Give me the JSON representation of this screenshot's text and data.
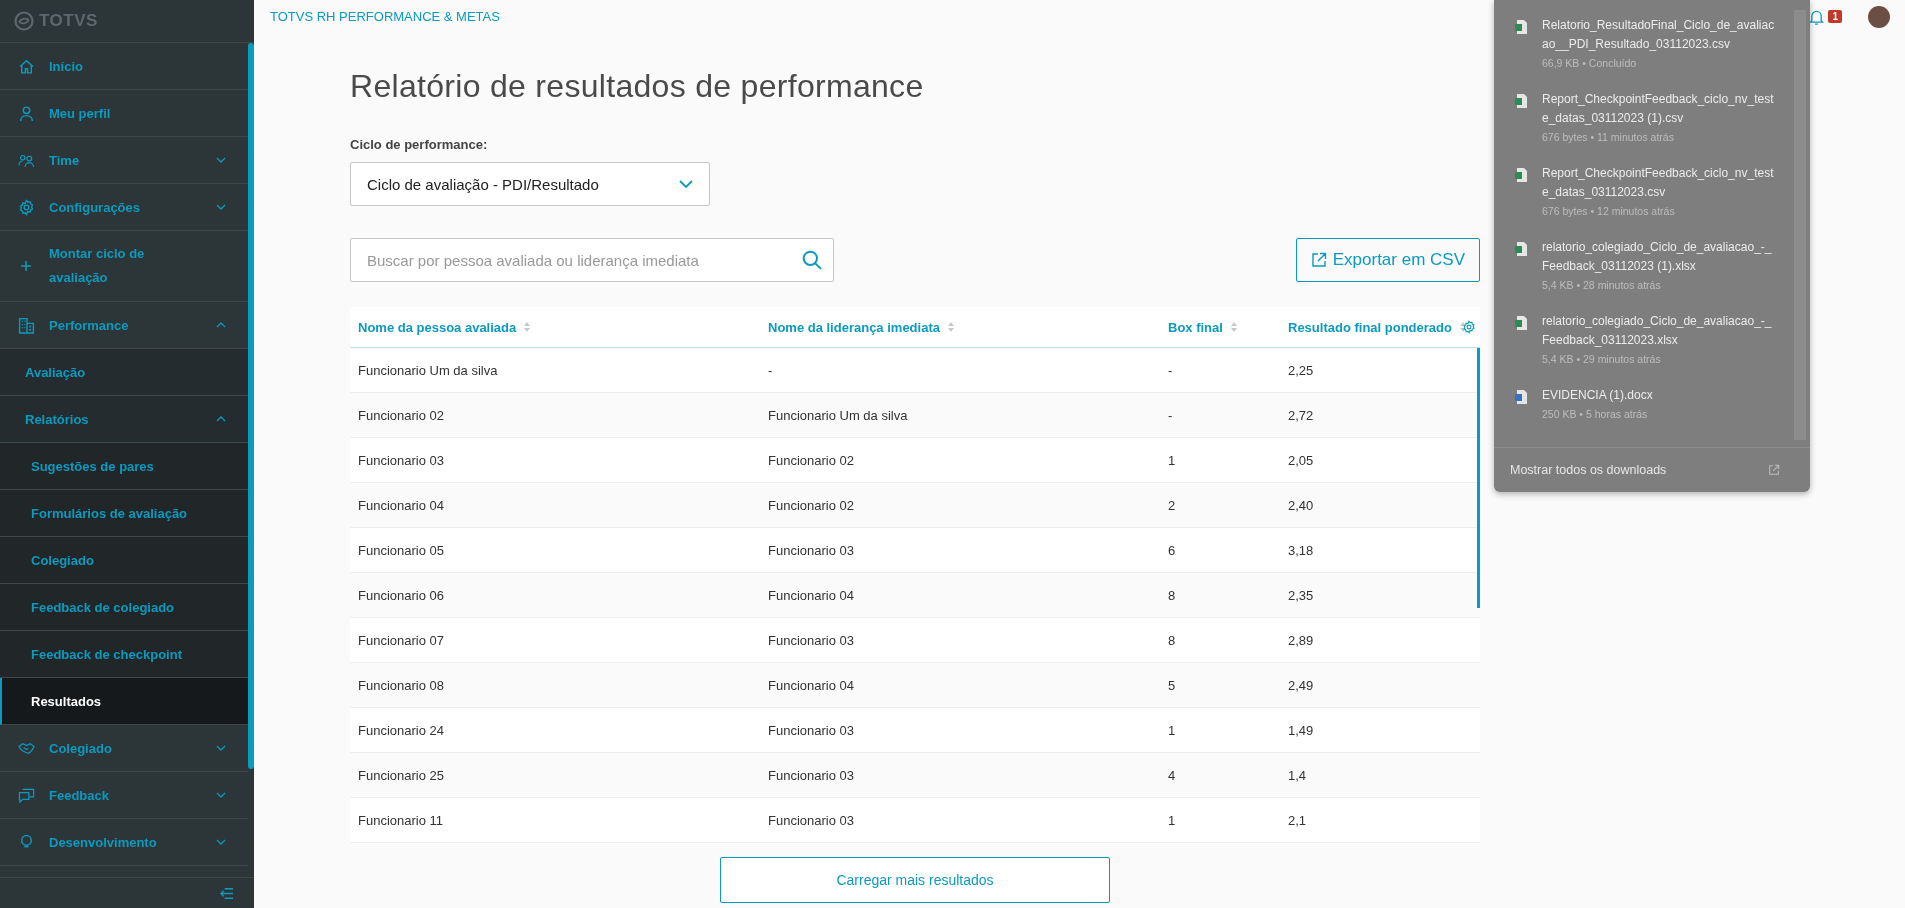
{
  "sidebar": {
    "logo": "TOTVS",
    "items": [
      {
        "label": "Início",
        "selected": false
      },
      {
        "label": "Meu perfil",
        "selected": false
      },
      {
        "label": "Time",
        "selected": false,
        "expanded": false
      },
      {
        "label": "Configurações",
        "selected": false,
        "expanded": false
      },
      {
        "label": "Montar ciclo de avaliação",
        "selected": false
      },
      {
        "label": "Performance",
        "selected": false,
        "expanded": true,
        "children": [
          {
            "label": "Avaliação",
            "selected": false
          },
          {
            "label": "Relatórios",
            "selected": false,
            "expanded": true,
            "children": [
              {
                "label": "Sugestões de pares",
                "selected": false
              },
              {
                "label": "Formulários de avaliação",
                "selected": false
              },
              {
                "label": "Colegiado",
                "selected": false
              },
              {
                "label": "Feedback de colegiado",
                "selected": false
              },
              {
                "label": "Feedback de checkpoint",
                "selected": false
              },
              {
                "label": "Resultados",
                "selected": true
              }
            ]
          }
        ]
      },
      {
        "label": "Colegiado",
        "selected": false,
        "expanded": false
      },
      {
        "label": "Feedback",
        "selected": false,
        "expanded": false
      },
      {
        "label": "Desenvolvimento",
        "selected": false,
        "expanded": false
      }
    ]
  },
  "header": {
    "app_title": "TOTVS RH PERFORMANCE & METAS",
    "notification_count": "1"
  },
  "page": {
    "title": "Relatório de resultados de performance",
    "cycle_label": "Ciclo de performance:",
    "cycle_value": "Ciclo de avaliação - PDI/Resultado",
    "search": {
      "placeholder": "Buscar por pessoa avaliada ou liderança imediata"
    },
    "export_button": "Exportar em CSV",
    "table": {
      "columns": [
        "Nome da pessoa avaliada",
        "Nome da liderança imediata",
        "Box final",
        "Resultado final ponderado"
      ],
      "rows": [
        [
          "Funcionario Um da silva",
          "-",
          "-",
          "2,25"
        ],
        [
          "Funcionario 02",
          "Funcionario Um da silva",
          "-",
          "2,72"
        ],
        [
          "Funcionario 03",
          "Funcionario 02",
          "1",
          "2,05"
        ],
        [
          "Funcionario 04",
          "Funcionario 02",
          "2",
          "2,40"
        ],
        [
          "Funcionario 05",
          "Funcionario 03",
          "6",
          "3,18"
        ],
        [
          "Funcionario 06",
          "Funcionario 04",
          "8",
          "2,35"
        ],
        [
          "Funcionario 07",
          "Funcionario 03",
          "8",
          "2,89"
        ],
        [
          "Funcionario 08",
          "Funcionario 04",
          "5",
          "2,49"
        ],
        [
          "Funcionario 24",
          "Funcionario 03",
          "1",
          "1,49"
        ],
        [
          "Funcionario 25",
          "Funcionario 03",
          "4",
          "1,4"
        ],
        [
          "Funcionario 11",
          "Funcionario 03",
          "1",
          "2,1"
        ]
      ]
    },
    "load_more": "Carregar mais resultados"
  },
  "downloads": {
    "items": [
      {
        "kind": "spreadsheet",
        "name": "Relatorio_ResultadoFinal_Ciclo_de_avaliacao__PDI_Resultado_03112023.csv",
        "meta": "66,9 KB • Concluído"
      },
      {
        "kind": "spreadsheet",
        "name": "Report_CheckpointFeedback_ciclo_nv_teste_datas_03112023 (1).csv",
        "meta": "676 bytes • 11 minutos atrás"
      },
      {
        "kind": "spreadsheet",
        "name": "Report_CheckpointFeedback_ciclo_nv_teste_datas_03112023.csv",
        "meta": "676 bytes • 12 minutos atrás"
      },
      {
        "kind": "spreadsheet",
        "name": "relatorio_colegiado_Ciclo_de_avaliacao_-_Feedback_03112023 (1).xlsx",
        "meta": "5,4 KB • 28 minutos atrás"
      },
      {
        "kind": "spreadsheet",
        "name": "relatorio_colegiado_Ciclo_de_avaliacao_-_Feedback_03112023.xlsx",
        "meta": "5,4 KB • 29 minutos atrás"
      },
      {
        "kind": "document",
        "name": "EVIDENCIA (1).docx",
        "meta": "250 KB • 5 horas atrás"
      }
    ],
    "footer": "Mostrar todos os downloads"
  }
}
